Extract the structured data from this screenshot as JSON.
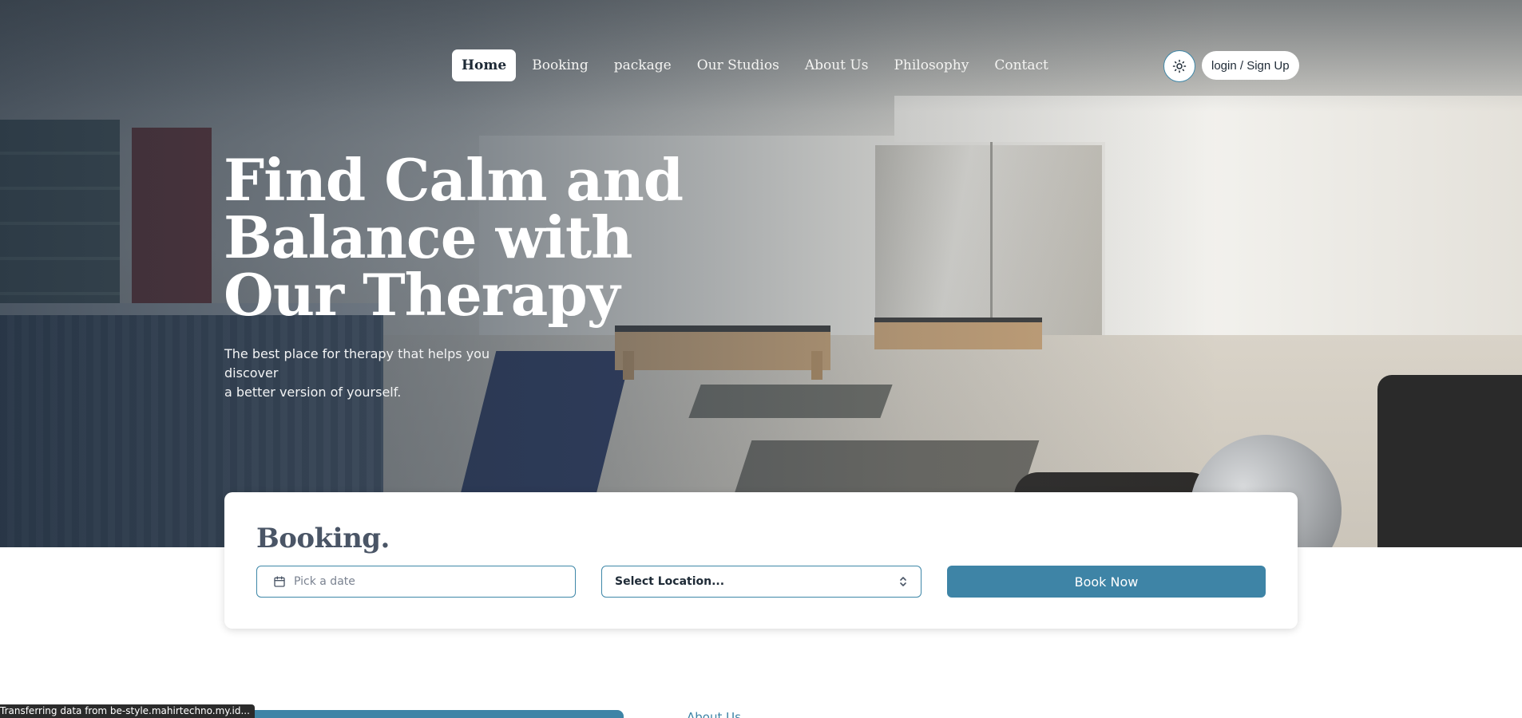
{
  "nav": {
    "items": [
      {
        "label": "Home",
        "active": true
      },
      {
        "label": "Booking",
        "active": false
      },
      {
        "label": "package",
        "active": false
      },
      {
        "label": "Our Studios",
        "active": false
      },
      {
        "label": "About Us",
        "active": false
      },
      {
        "label": "Philosophy",
        "active": false
      },
      {
        "label": "Contact",
        "active": false
      }
    ],
    "theme_icon": "sun-icon",
    "login_label": "login / Sign Up"
  },
  "hero": {
    "title_lines": [
      "Find Calm and",
      "Balance with",
      "Our Therapy"
    ],
    "subtitle_lines": [
      "The best place for therapy that helps you discover",
      "a better version of yourself."
    ]
  },
  "booking": {
    "title": "Booking.",
    "date_placeholder": "Pick a date",
    "date_icon": "calendar-icon",
    "location_value": "Select Location...",
    "location_icon": "chevron-up-down-icon",
    "book_label": "Book Now"
  },
  "below": {
    "about_link": "About Us"
  },
  "status_bar": "Transferring data from be-style.mahirtechno.my.id...",
  "colors": {
    "accent": "#3e84a6",
    "heading": "#4a5566",
    "nav_text": "#f4f4f2"
  }
}
